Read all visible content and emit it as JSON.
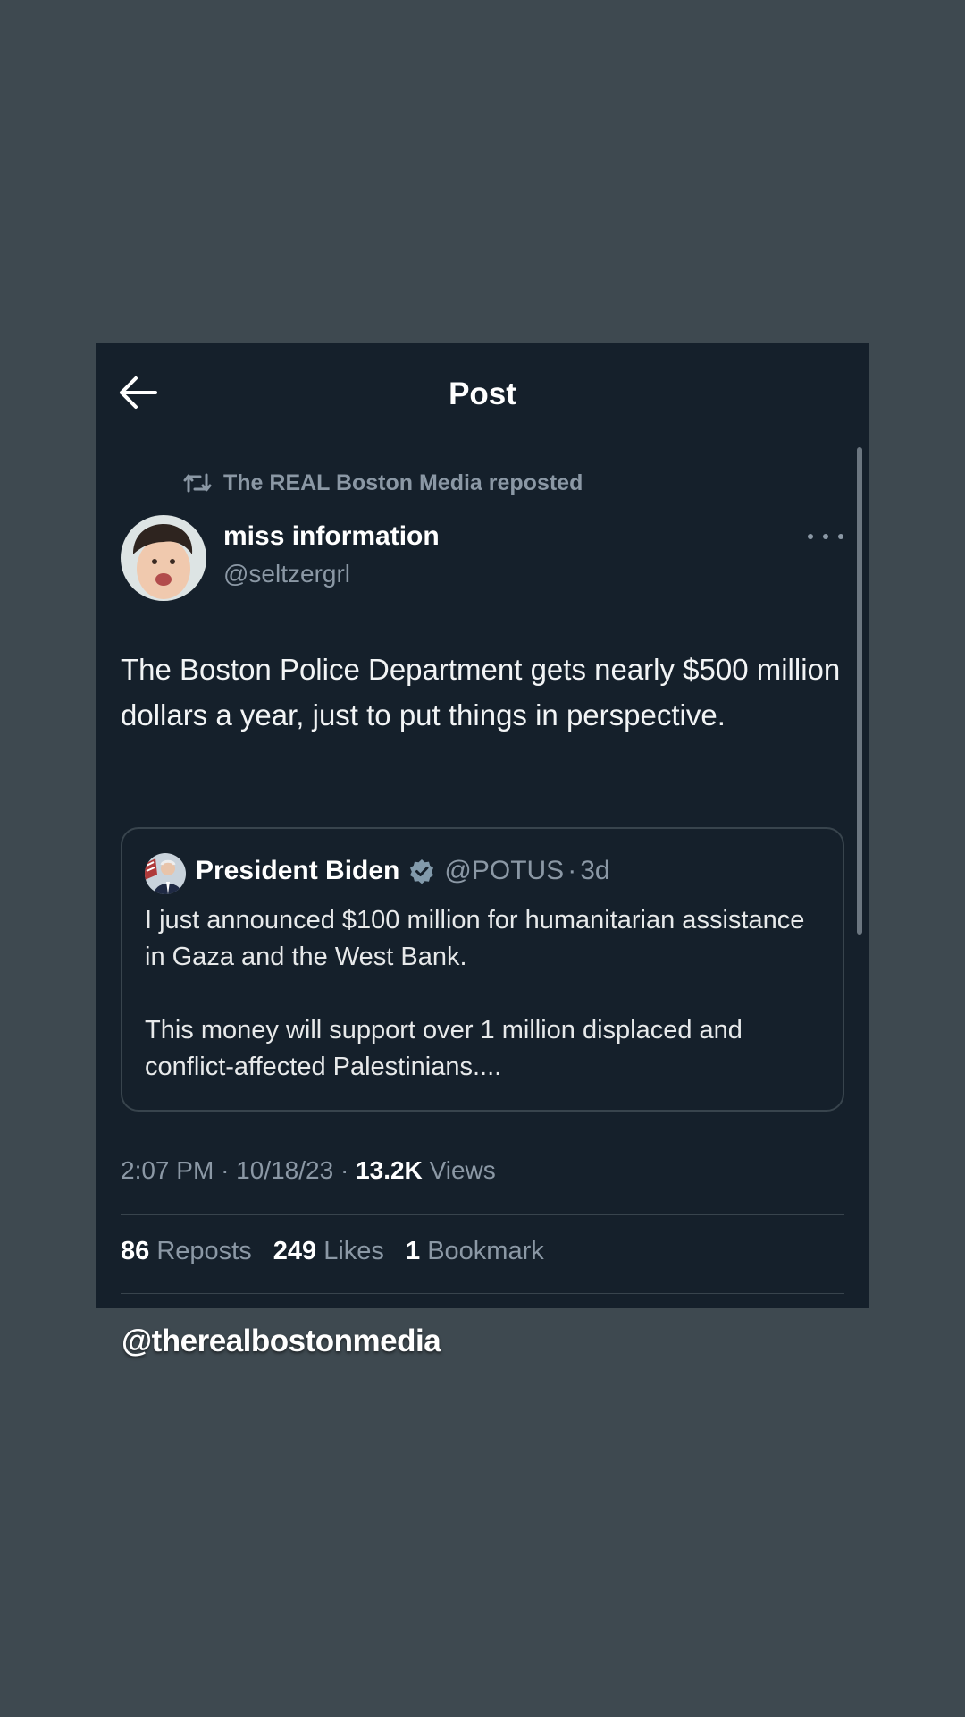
{
  "header": {
    "title": "Post"
  },
  "repost": {
    "text": "The REAL Boston Media reposted"
  },
  "author": {
    "name": "miss information",
    "handle": "@seltzergrl"
  },
  "post": {
    "text": "The Boston Police Department gets nearly $500 million dollars a year, just to put things in perspective.",
    "time": "2:07 PM",
    "date": "10/18/23",
    "views_count": "13.2K",
    "views_label": "Views"
  },
  "quote": {
    "name": "President Biden",
    "handle": "@POTUS",
    "time": "3d",
    "paragraph1": "I just announced $100 million for humanitarian assistance in Gaza and the West Bank.",
    "paragraph2": "This money will support over 1 million displaced and conflict-affected Palestinians...."
  },
  "stats": {
    "reposts_count": "86",
    "reposts_label": "Reposts",
    "likes_count": "249",
    "likes_label": "Likes",
    "bookmarks_count": "1",
    "bookmarks_label": "Bookmark"
  },
  "watermark": "@therealbostonmedia",
  "icons": {
    "back": "arrow-left-icon",
    "repost": "repost-icon",
    "more": "more-icon",
    "verified": "verified-badge-icon"
  },
  "colors": {
    "background": "#3e4950",
    "card": "#15202b",
    "text_primary": "#e7e9ea",
    "text_secondary": "#8b98a5",
    "border": "#38444d",
    "verified": "#829aab"
  }
}
